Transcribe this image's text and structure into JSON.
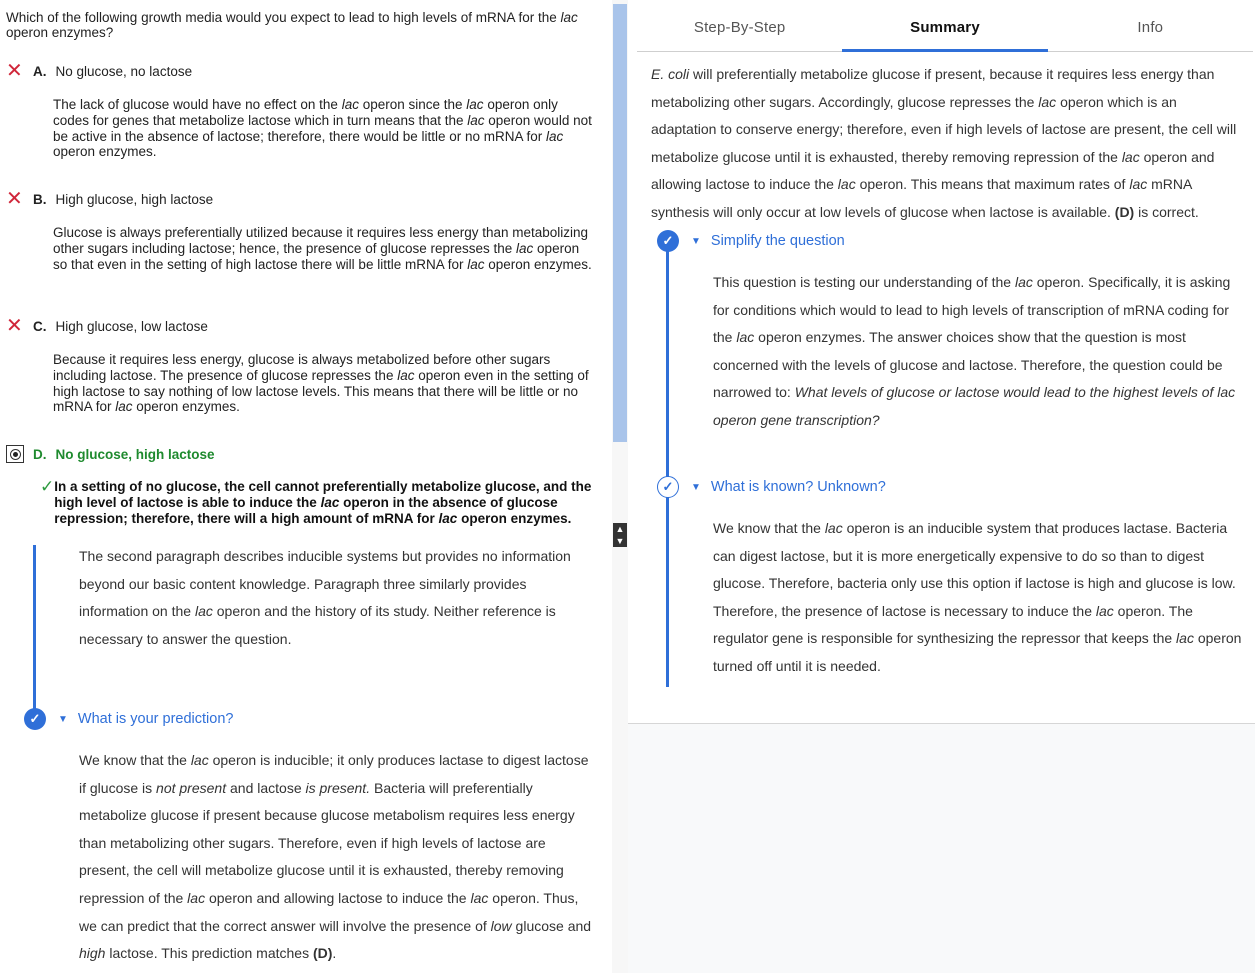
{
  "question": {
    "text_a": "Which of the following growth media would you expect to lead to high levels of mRNA for the ",
    "text_em": "lac",
    "text_b": " operon enzymes?"
  },
  "choices": {
    "a": {
      "letter": "A.",
      "label": "No glucose, no lactose",
      "expl": [
        {
          "t": "The lack of glucose would have no effect on the "
        },
        {
          "t": "lac",
          "i": true
        },
        {
          "t": " operon since the "
        },
        {
          "t": "lac",
          "i": true
        },
        {
          "t": " operon only codes for genes that metabolize lactose which in turn means that the "
        },
        {
          "t": "lac",
          "i": true
        },
        {
          "t": " operon would not be active in the absence of lactose; therefore, there would be little or no mRNA for "
        },
        {
          "t": "lac",
          "i": true
        },
        {
          "t": " operon enzymes."
        }
      ]
    },
    "b": {
      "letter": "B.",
      "label": "High glucose, high lactose",
      "expl": [
        {
          "t": "Glucose is always preferentially utilized because it requires less energy than metabolizing other sugars including lactose; hence, the presence of glucose represses the "
        },
        {
          "t": "lac",
          "i": true
        },
        {
          "t": " operon so that even in the setting of high lactose there will be little mRNA for "
        },
        {
          "t": "lac",
          "i": true
        },
        {
          "t": " operon enzymes."
        }
      ]
    },
    "c": {
      "letter": "C.",
      "label": "High glucose, low lactose",
      "expl": [
        {
          "t": "Because it requires less energy, glucose is always metabolized before other sugars including lactose. The presence of glucose represses the "
        },
        {
          "t": "lac",
          "i": true
        },
        {
          "t": " operon even in the setting of high lactose to say nothing of low lactose levels. This means that there will be little or no mRNA for "
        },
        {
          "t": "lac",
          "i": true
        },
        {
          "t": " operon enzymes."
        }
      ]
    },
    "d": {
      "letter": "D.",
      "label": "No glucose, high lactose",
      "expl": [
        {
          "t": "In a setting of no glucose, the cell cannot preferentially metabolize glucose, and the high level of lactose is able to induce the "
        },
        {
          "t": "lac",
          "i": true
        },
        {
          "t": " operon in the absence of glucose repression; therefore, there will a high amount of mRNA for "
        },
        {
          "t": "lac",
          "i": true
        },
        {
          "t": " operon enzymes."
        }
      ]
    }
  },
  "icons": {
    "x": "✕",
    "check": "✓",
    "step_check": "✓",
    "caret": "▼",
    "up": "▲",
    "down": "▼"
  },
  "left_steps": {
    "para1": [
      {
        "t": "The second paragraph describes inducible systems but provides no information beyond our basic content knowledge. Paragraph three similarly provides information on the "
      },
      {
        "t": "lac",
        "i": true
      },
      {
        "t": " operon and the history of its study. Neither reference is necessary to answer the question."
      }
    ],
    "prediction_title": "What is your prediction?",
    "para2": [
      {
        "t": "We know that the "
      },
      {
        "t": "lac",
        "i": true
      },
      {
        "t": " operon is inducible; it only produces lactase to digest lactose if glucose is "
      },
      {
        "t": "not present",
        "i": true
      },
      {
        "t": " and lactose "
      },
      {
        "t": "is present.",
        "i": true
      },
      {
        "t": " Bacteria will preferentially metabolize glucose if present because glucose metabolism requires less energy than metabolizing other sugars. Therefore, even if high levels of lactose are present, the cell will metabolize glucose until it is exhausted, thereby removing repression of the "
      },
      {
        "t": "lac",
        "i": true
      },
      {
        "t": " operon and allowing lactose to induce the "
      },
      {
        "t": "lac",
        "i": true
      },
      {
        "t": " operon. Thus, we can predict that the correct answer will involve the presence of "
      },
      {
        "t": "low",
        "i": true
      },
      {
        "t": " glucose and "
      },
      {
        "t": "high",
        "i": true
      },
      {
        "t": " lactose. This prediction matches "
      },
      {
        "t": "(D)",
        "b": true
      },
      {
        "t": "."
      }
    ]
  },
  "tabs": [
    "Step-By-Step",
    "Summary",
    "Info"
  ],
  "summary": {
    "para0": [
      {
        "t": "E. coli",
        "i": true
      },
      {
        "t": " will preferentially metabolize glucose if present, because it requires less energy than metabolizing other sugars. Accordingly, glucose represses the "
      },
      {
        "t": "lac",
        "i": true
      },
      {
        "t": " operon which is an adaptation to conserve energy; therefore, even if high levels of lactose are present, the cell will metabolize glucose until it is exhausted, thereby removing repression of the "
      },
      {
        "t": "lac",
        "i": true
      },
      {
        "t": " operon and allowing lactose to induce the "
      },
      {
        "t": "lac",
        "i": true
      },
      {
        "t": " operon. This means that maximum rates of "
      },
      {
        "t": "lac",
        "i": true
      },
      {
        "t": " mRNA synthesis will only occur at low levels of glucose when lactose is available. "
      },
      {
        "t": "(D)",
        "b": true
      },
      {
        "t": " is correct."
      }
    ],
    "step1_title": "Simplify the question",
    "step1_para": [
      {
        "t": "This question is testing our understanding of the "
      },
      {
        "t": "lac",
        "i": true
      },
      {
        "t": " operon. Specifically, it is asking for conditions which would to lead to high levels of transcription of mRNA coding for the "
      },
      {
        "t": "lac",
        "i": true
      },
      {
        "t": " operon enzymes. The answer choices show that the question is most concerned with the levels of glucose and lactose. Therefore, the question could be narrowed to: "
      },
      {
        "t": "What levels of glucose or lactose would lead to the highest levels of lac operon gene transcription?",
        "i": true
      }
    ],
    "step2_title": "What is known? Unknown?",
    "step2_para": [
      {
        "t": "We know that the "
      },
      {
        "t": "lac",
        "i": true
      },
      {
        "t": " operon is an inducible system that produces lactase. Bacteria can digest lactose, but it is more energetically expensive to do so than to digest glucose. Therefore, bacteria only use this option if lactose is high and glucose is low. Therefore, the presence of lactose is necessary to induce the "
      },
      {
        "t": "lac",
        "i": true
      },
      {
        "t": " operon. The regulator gene is responsible for synthesizing the repressor that keeps the "
      },
      {
        "t": "lac",
        "i": true
      },
      {
        "t": " operon turned off until it is needed."
      }
    ]
  }
}
